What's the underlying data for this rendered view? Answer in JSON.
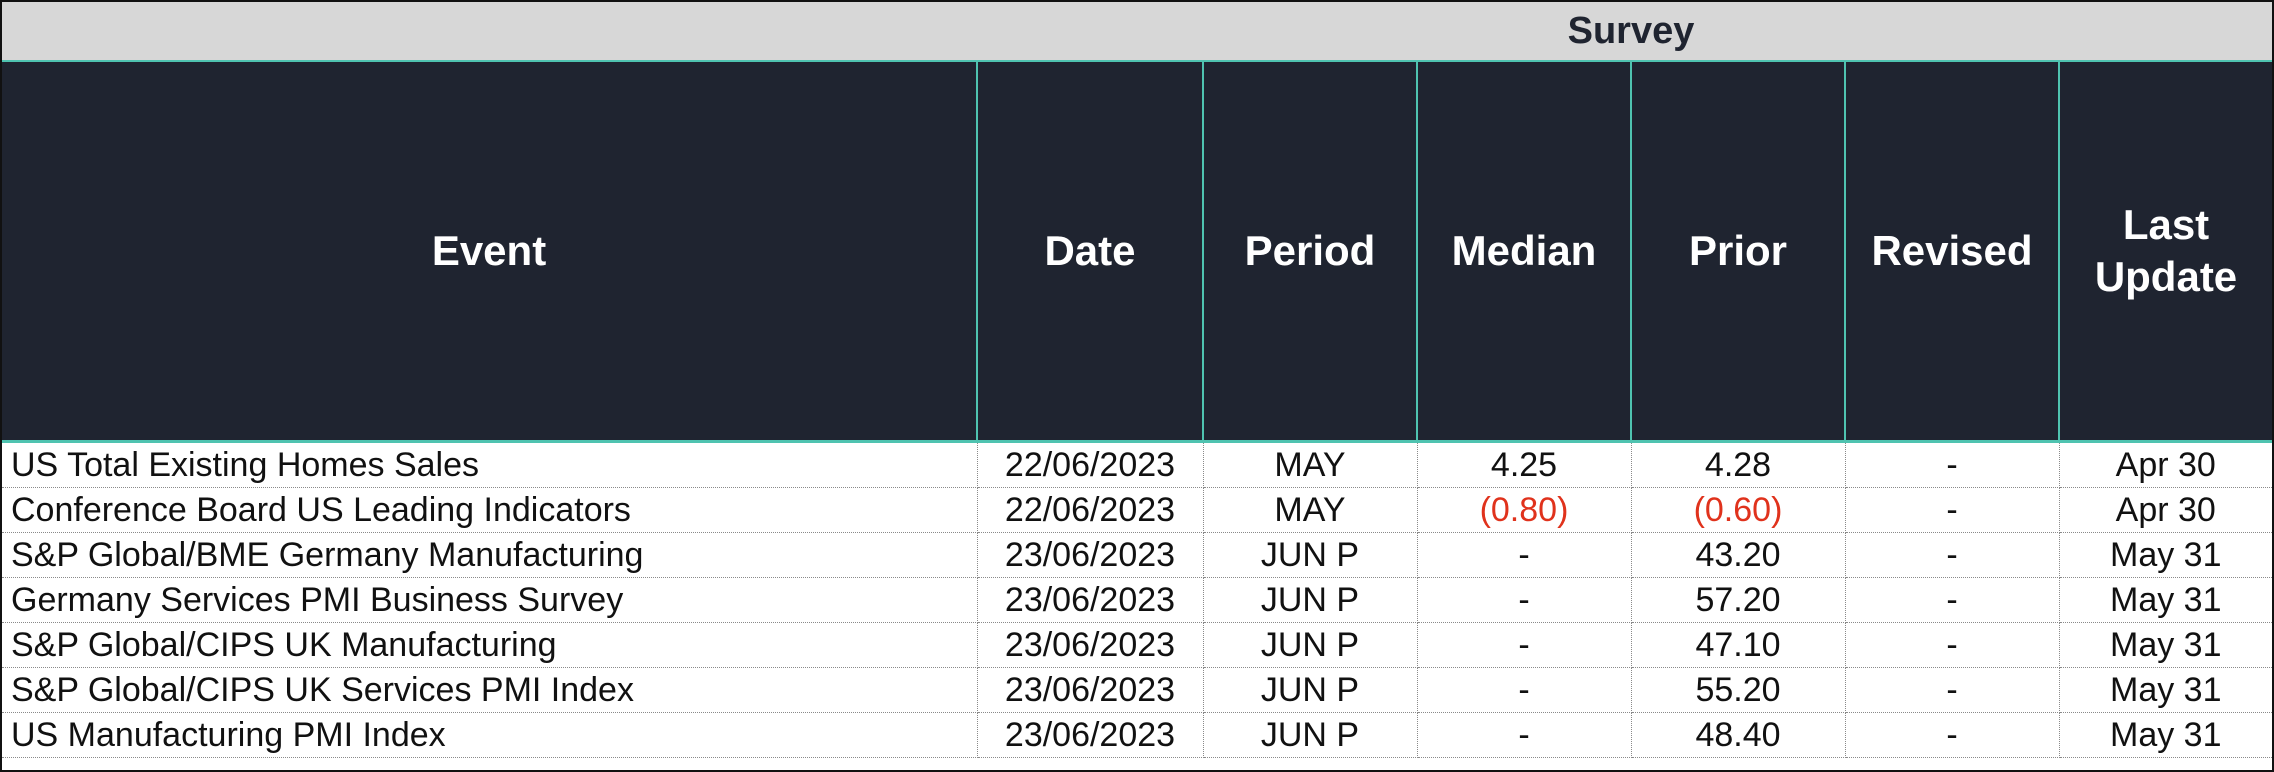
{
  "band": {
    "label": "Survey"
  },
  "headers": {
    "event": "Event",
    "date": "Date",
    "period": "Period",
    "median": "Median",
    "prior": "Prior",
    "revised": "Revised",
    "last_update_line1": "Last",
    "last_update_line2": "Update"
  },
  "colors": {
    "header_bg": "#1f2430",
    "band_bg": "#d7d7d7",
    "accent": "#4fc3b0",
    "negative": "#e0321c"
  },
  "rows": [
    {
      "event": "US Total Existing Homes Sales",
      "date": "22/06/2023",
      "period": "MAY",
      "median": "4.25",
      "prior": "4.28",
      "revised": "-",
      "last_update": "Apr 30"
    },
    {
      "event": "Conference Board US Leading Indicators",
      "date": "22/06/2023",
      "period": "MAY",
      "median": "(0.80)",
      "prior": "(0.60)",
      "revised": "-",
      "last_update": "Apr 30"
    },
    {
      "event": "S&P Global/BME Germany Manufacturing",
      "date": "23/06/2023",
      "period": "JUN P",
      "median": "-",
      "prior": "43.20",
      "revised": "-",
      "last_update": "May 31"
    },
    {
      "event": "Germany Services PMI Business Survey",
      "date": "23/06/2023",
      "period": "JUN P",
      "median": "-",
      "prior": "57.20",
      "revised": "-",
      "last_update": "May 31"
    },
    {
      "event": "S&P Global/CIPS UK Manufacturing",
      "date": "23/06/2023",
      "period": "JUN P",
      "median": "-",
      "prior": "47.10",
      "revised": "-",
      "last_update": "May 31"
    },
    {
      "event": "S&P Global/CIPS UK Services PMI Index",
      "date": "23/06/2023",
      "period": "JUN P",
      "median": "-",
      "prior": "55.20",
      "revised": "-",
      "last_update": "May 31"
    },
    {
      "event": "US Manufacturing PMI Index",
      "date": "23/06/2023",
      "period": "JUN P",
      "median": "-",
      "prior": "48.40",
      "revised": "-",
      "last_update": "May 31"
    }
  ]
}
